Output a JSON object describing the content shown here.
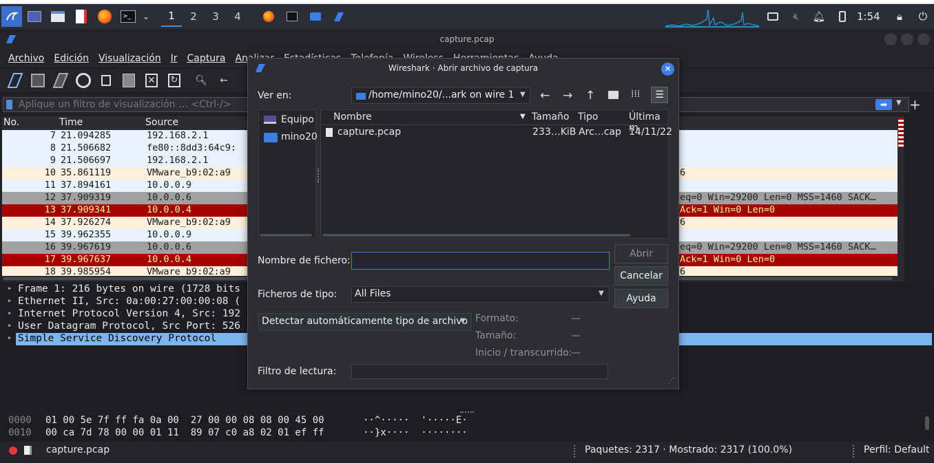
{
  "taskbar": {
    "workspaces": [
      "1",
      "2",
      "3",
      "4"
    ],
    "clock": "1:54"
  },
  "window": {
    "title": "capture.pcap"
  },
  "menu": [
    "Archivo",
    "Edición",
    "Visualización",
    "Ir",
    "Captura",
    "Analizar",
    "Estadísticas",
    "Telefonía",
    "Wireless",
    "Herramientas",
    "Ayuda"
  ],
  "filter": {
    "placeholder": "Aplique un filtro de visualización … <Ctrl-/>"
  },
  "packet_list": {
    "columns": [
      "No.",
      "Time",
      "Source"
    ],
    "rows": [
      {
        "no": "7",
        "time": "21.094285",
        "src": "192.168.2.1",
        "info": "",
        "color": "blue"
      },
      {
        "no": "8",
        "time": "21.506682",
        "src": "fe80::8dd3:64c9:",
        "info": "",
        "color": "blue"
      },
      {
        "no": "9",
        "time": "21.506697",
        "src": "192.168.2.1",
        "info": "",
        "color": "blue"
      },
      {
        "no": "10",
        "time": "35.861119",
        "src": "VMware_b9:02:a9",
        "info": "6",
        "color": "tan"
      },
      {
        "no": "11",
        "time": "37.894161",
        "src": "10.0.0.9",
        "info": "",
        "color": "blue"
      },
      {
        "no": "12",
        "time": "37.909319",
        "src": "10.0.0.6",
        "info": "eq=0 Win=29200 Len=0 MSS=1460 SACK…",
        "color": "gray"
      },
      {
        "no": "13",
        "time": "37.909341",
        "src": "10.0.0.4",
        "info": "Ack=1 Win=0 Len=0",
        "color": "red"
      },
      {
        "no": "14",
        "time": "37.926274",
        "src": "VMware_b9:02:a9",
        "info": "6",
        "color": "tan"
      },
      {
        "no": "15",
        "time": "39.962355",
        "src": "10.0.0.9",
        "info": "",
        "color": "blue"
      },
      {
        "no": "16",
        "time": "39.967619",
        "src": "10.0.0.6",
        "info": "eq=0 Win=29200 Len=0 MSS=1460 SACK…",
        "color": "gray"
      },
      {
        "no": "17",
        "time": "39.967637",
        "src": "10.0.0.4",
        "info": "Ack=1 Win=0 Len=0",
        "color": "red"
      },
      {
        "no": "18",
        "time": "39.985954",
        "src": "VMware_b9:02:a9",
        "info": "6",
        "color": "tan"
      }
    ]
  },
  "details": [
    {
      "text": "Frame 1: 216 bytes on wire (1728 bits",
      "selected": false
    },
    {
      "text": "Ethernet II, Src: 0a:00:27:00:00:08 (",
      "selected": false
    },
    {
      "text": "Internet Protocol Version 4, Src: 192",
      "selected": false
    },
    {
      "text": "User Datagram Protocol, Src Port: 526",
      "selected": false
    },
    {
      "text": "Simple Service Discovery Protocol",
      "selected": true
    }
  ],
  "bytes": [
    {
      "offset": "0000",
      "hex": "01 00 5e 7f ff fa 0a 00  27 00 00 08 08 00 45 00",
      "ascii": "··^·····  '·····E·"
    },
    {
      "offset": "0010",
      "hex": "00 ca 7d 78 00 00 01 11  89 07 c0 a8 02 01 ef ff",
      "ascii": "··}x····  ········"
    }
  ],
  "status": {
    "file": "capture.pcap",
    "packets": "Paquetes: 2317 · Mostrado: 2317 (100.0%)",
    "profile": "Perfil: Default"
  },
  "dialog": {
    "title": "Wireshark · Abrir archivo de captura",
    "look_in_label": "Ver en:",
    "look_in_path": "/home/mino20/...ark on wire 1",
    "places": [
      "Equipo",
      "mino20"
    ],
    "file_columns": [
      "Nombre",
      "Tamaño",
      "Tipo",
      "Última m"
    ],
    "files": [
      {
        "name": "capture.pcap",
        "size": "233…KiB",
        "type": "Arc…cap",
        "date": "14/11/22"
      }
    ],
    "filename_label": "Nombre de fichero:",
    "filename_value": "",
    "filetype_label": "Ficheros de tipo:",
    "filetype_value": "All Files",
    "open_button": "Abrir",
    "cancel_button": "Cancelar",
    "help_button": "Ayuda",
    "format_combo": "Detectar automáticamente tipo de archivo",
    "format_label": "Formato:",
    "size_label": "Tamaño:",
    "start_label": "Inicio / transcurrido:",
    "dash": "—",
    "read_filter_label": "Filtro de lectura:"
  }
}
